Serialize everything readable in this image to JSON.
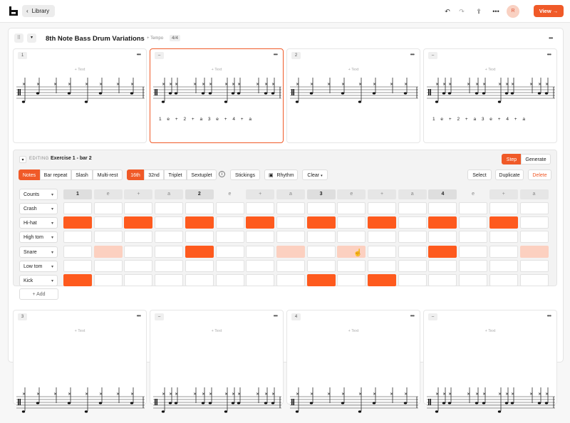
{
  "topbar": {
    "back_label": "Library",
    "avatar_initial": "R",
    "view_label": "View →"
  },
  "header": {
    "title": "8th Note Bass Drum Variations",
    "tempo_label": "+ Tempo",
    "time_signature": "4/4"
  },
  "cards_top": [
    {
      "num": "1",
      "text": "+ Text",
      "counts": ""
    },
    {
      "num": "–",
      "text": "+ Text",
      "counts": "1 e + 2 + a 3 e + 4 + a"
    },
    {
      "num": "2",
      "text": "+ Text",
      "counts": ""
    },
    {
      "num": "–",
      "text": "+ Text",
      "counts": "1 e + 2 + a 3 e + 4 + a"
    }
  ],
  "cards_bottom": [
    {
      "num": "3",
      "text": "+ Text"
    },
    {
      "num": "–",
      "text": "+ Text"
    },
    {
      "num": "4",
      "text": "+ Text"
    },
    {
      "num": "–",
      "text": "+ Text"
    }
  ],
  "editor": {
    "editing_label": "EDITING",
    "name": "Exercise 1 - bar 2",
    "mode_step": "Step",
    "mode_generate": "Generate",
    "tabs": [
      "Notes",
      "Bar repeat",
      "Slash",
      "Multi-rest"
    ],
    "subdivisions": [
      "16th",
      "32nd",
      "Triplet",
      "Sextuplet"
    ],
    "stickings": "Stickings",
    "rhythm": "Rhythm",
    "clear": "Clear",
    "select": "Select",
    "duplicate": "Duplicate",
    "delete": "Delete",
    "counts_label": "Counts",
    "grid_headers": [
      "1",
      "e",
      "+",
      "a",
      "2",
      "e",
      "+",
      "a",
      "3",
      "e",
      "+",
      "a",
      "4",
      "e",
      "+",
      "a"
    ],
    "rows": [
      {
        "label": "Crash",
        "cells": [
          0,
          0,
          0,
          0,
          0,
          0,
          0,
          0,
          0,
          0,
          0,
          0,
          0,
          0,
          0,
          0
        ]
      },
      {
        "label": "Hi-hat",
        "cells": [
          1,
          0,
          1,
          0,
          1,
          0,
          1,
          0,
          1,
          0,
          1,
          0,
          1,
          0,
          1,
          0
        ]
      },
      {
        "label": "High tom",
        "cells": [
          0,
          0,
          0,
          0,
          0,
          0,
          0,
          0,
          0,
          0,
          0,
          0,
          0,
          0,
          0,
          0
        ]
      },
      {
        "label": "Snare",
        "cells": [
          0,
          2,
          0,
          0,
          1,
          0,
          0,
          2,
          0,
          2,
          0,
          0,
          1,
          0,
          0,
          2
        ]
      },
      {
        "label": "Low tom",
        "cells": [
          0,
          0,
          0,
          0,
          0,
          0,
          0,
          0,
          0,
          0,
          0,
          0,
          0,
          0,
          0,
          0
        ]
      },
      {
        "label": "Kick",
        "cells": [
          1,
          0,
          0,
          0,
          0,
          0,
          0,
          0,
          1,
          0,
          1,
          0,
          0,
          0,
          0,
          0
        ]
      }
    ],
    "add_label": "+ Add"
  },
  "colors": {
    "accent": "#f05a28",
    "active_cell": "#fe5a1e",
    "ghost_cell": "#fcd0c0"
  }
}
